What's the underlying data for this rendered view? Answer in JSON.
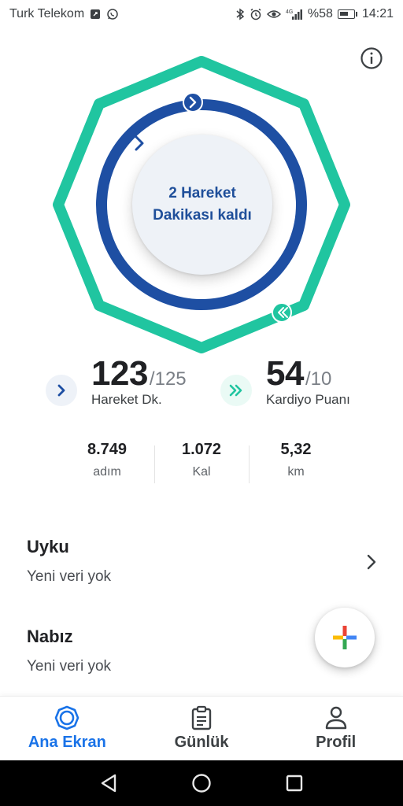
{
  "status_bar": {
    "carrier": "Turk Telekom",
    "battery_percent": "%58",
    "time": "14:21",
    "network": "4G"
  },
  "ring": {
    "message_line1": "2 Hareket",
    "message_line2": "Dakikası kaldı",
    "colors": {
      "outer": "#20c5a0",
      "inner": "#1e4fa3"
    }
  },
  "goals": {
    "move": {
      "value": "123",
      "target": "/125",
      "label": "Hareket Dk.",
      "progress": 0.984
    },
    "heart": {
      "value": "54",
      "target": "/10",
      "label": "Kardiyo Puanı",
      "progress": 1.0
    }
  },
  "stats": [
    {
      "value": "8.749",
      "label": "adım"
    },
    {
      "value": "1.072",
      "label": "Kal"
    },
    {
      "value": "5,32",
      "label": "km"
    }
  ],
  "cards": {
    "sleep": {
      "title": "Uyku",
      "subtitle": "Yeni veri yok"
    },
    "heart_rate": {
      "title": "Nabız",
      "subtitle": "Yeni veri yok"
    }
  },
  "bottom_nav": [
    {
      "label": "Ana Ekran",
      "active": true
    },
    {
      "label": "Günlük",
      "active": false
    },
    {
      "label": "Profil",
      "active": false
    }
  ],
  "icons": [
    "whatsapp-icon",
    "bluetooth-icon",
    "alarm-icon",
    "eye-icon",
    "signal-icon",
    "battery-icon",
    "info-icon",
    "chevron-right-icon",
    "double-chevron-icon",
    "plus-icon",
    "home-ring-icon",
    "clipboard-icon",
    "person-icon",
    "back-icon",
    "home-icon",
    "recents-icon"
  ]
}
